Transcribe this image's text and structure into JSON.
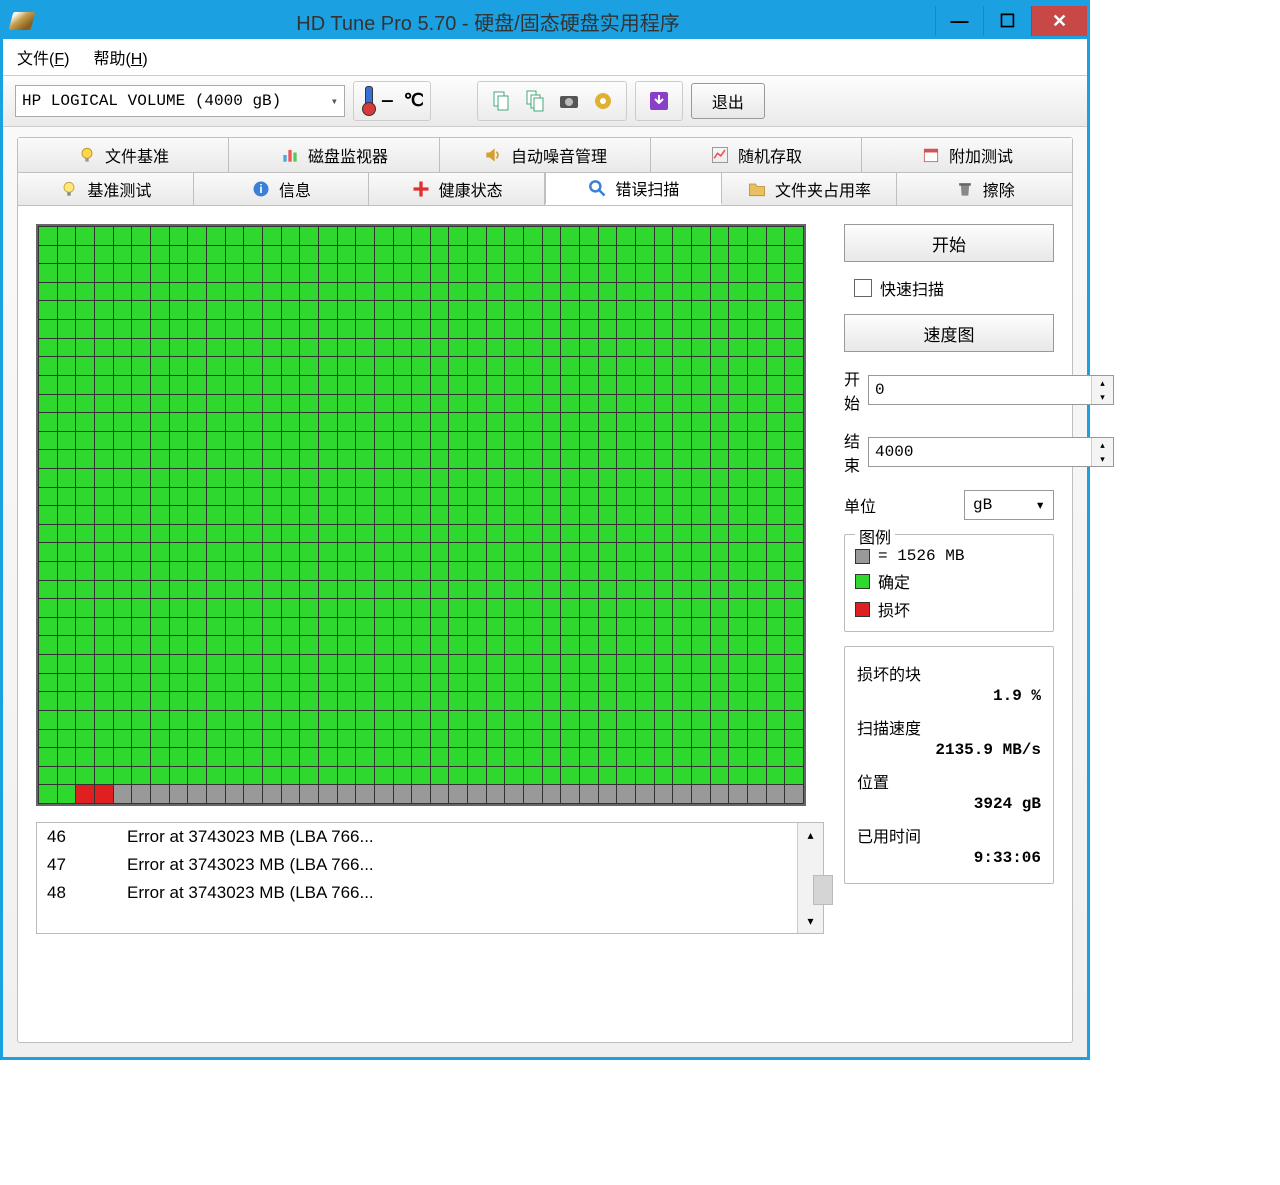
{
  "title": "HD Tune Pro 5.70 - 硬盘/固态硬盘实用程序",
  "menu": {
    "file": "文件(F)",
    "help": "帮助(H)"
  },
  "drive": "HP    LOGICAL VOLUME (4000 gB)",
  "temp": "— ℃",
  "exit": "退出",
  "tabs_top": [
    {
      "label": "文件基准",
      "icon": "bulb"
    },
    {
      "label": "磁盘监视器",
      "icon": "bars"
    },
    {
      "label": "自动噪音管理",
      "icon": "speaker"
    },
    {
      "label": "随机存取",
      "icon": "chart"
    },
    {
      "label": "附加测试",
      "icon": "calendar"
    }
  ],
  "tabs_bottom": [
    {
      "label": "基准测试",
      "icon": "bulb2"
    },
    {
      "label": "信息",
      "icon": "info"
    },
    {
      "label": "健康状态",
      "icon": "plus"
    },
    {
      "label": "错误扫描",
      "icon": "search",
      "active": true
    },
    {
      "label": "文件夹占用率",
      "icon": "folder"
    },
    {
      "label": "擦除",
      "icon": "trash"
    }
  ],
  "controls": {
    "start_btn": "开始",
    "quick_scan": "快速扫描",
    "speedmap_btn": "速度图",
    "start_label": "开始",
    "start_val": "0",
    "end_label": "结束",
    "end_val": "4000",
    "unit_label": "单位",
    "unit_val": "gB"
  },
  "legend": {
    "title": "图例",
    "block_size": "= 1526 MB",
    "ok": "确定",
    "bad": "损坏"
  },
  "stats": {
    "damaged_label": "损坏的块",
    "damaged_val": "1.9 %",
    "speed_label": "扫描速度",
    "speed_val": "2135.9 MB/s",
    "pos_label": "位置",
    "pos_val": "3924 gB",
    "elapsed_label": "已用时间",
    "elapsed_val": "9:33:06"
  },
  "errors": [
    {
      "n": "46",
      "msg": "Error at 3743023 MB (LBA 766..."
    },
    {
      "n": "47",
      "msg": "Error at 3743023 MB (LBA 766..."
    },
    {
      "n": "48",
      "msg": "Error at 3743023 MB (LBA 766..."
    }
  ],
  "grid": {
    "cols": 41,
    "rows": 31,
    "red_last_row": [
      2,
      3
    ],
    "grey_last_row_from": 4
  }
}
